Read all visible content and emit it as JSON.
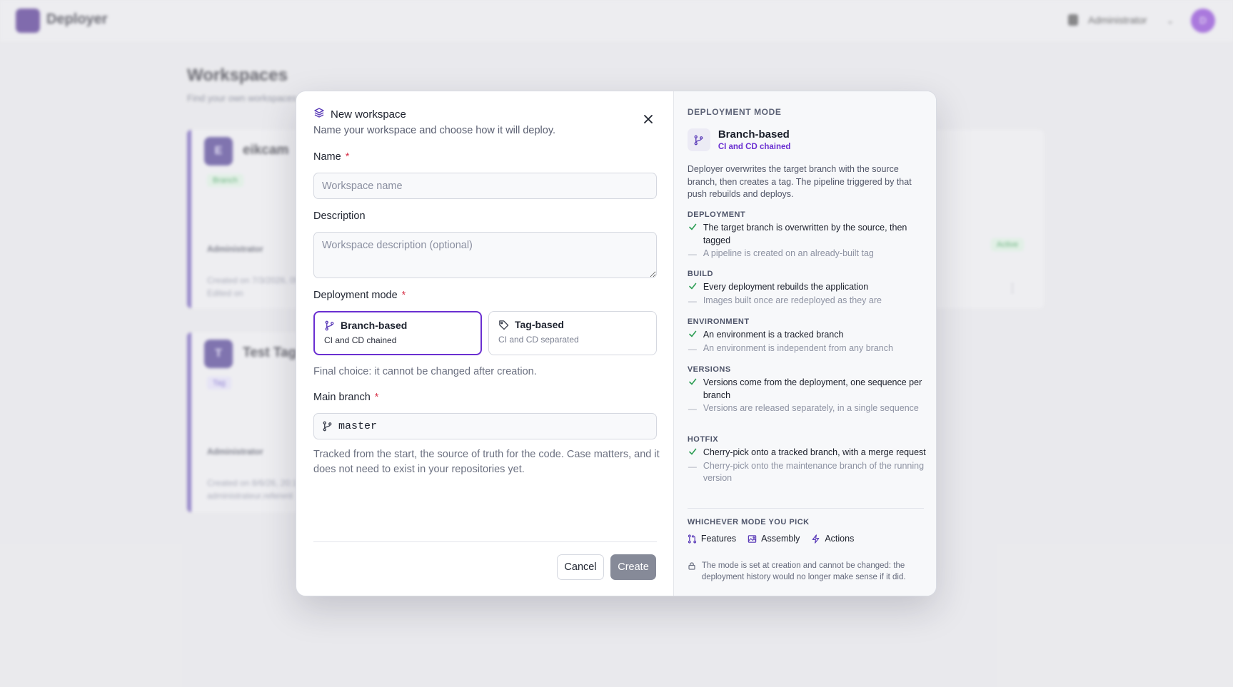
{
  "background": {
    "app_name": "Deployer",
    "user_role": "Administrator",
    "user_initial": "D",
    "page_title": "Workspaces",
    "page_subtitle": "Find your own workspaces",
    "cards": [
      {
        "initial": "E",
        "name": "eikcam",
        "badge": "Branch",
        "role": "Administrator",
        "meta": "Created on 7/3/2026, 09:",
        "meta2": "Edited on",
        "status": "Active"
      },
      {
        "initial": "T",
        "name": "Test Tag",
        "badge": "Tag",
        "role": "Administrator",
        "meta": "Created on 8/6/26, 20:12",
        "meta2": "administrateur.referent"
      }
    ]
  },
  "modal": {
    "title": "New workspace",
    "subtitle": "Name your workspace and choose how it will deploy.",
    "name_label": "Name",
    "name_placeholder": "Workspace name",
    "description_label": "Description",
    "description_placeholder": "Workspace description (optional)",
    "mode_label": "Deployment mode",
    "required_mark": "*",
    "modes": [
      {
        "title": "Branch-based",
        "subtitle": "CI and CD chained",
        "selected": true
      },
      {
        "title": "Tag-based",
        "subtitle": "CI and CD separated",
        "selected": false
      }
    ],
    "final_note": "Final choice: it cannot be changed after creation.",
    "branch_label": "Main branch",
    "branch_value": "master",
    "branch_help": "Tracked from the start, the source of truth for the code. Case matters, and it does not need to exist in your repositories yet.",
    "cancel_label": "Cancel",
    "create_label": "Create"
  },
  "panel": {
    "kicker": "DEPLOYMENT MODE",
    "mode_title": "Branch-based",
    "mode_subtitle": "CI and CD chained",
    "description": "Deployer overwrites the target branch with the source branch, then creates a tag. The pipeline triggered by that push rebuilds and deploys.",
    "sections": [
      {
        "heading": "DEPLOYMENT",
        "yes": "The target branch is overwritten by the source, then tagged",
        "no": "A pipeline is created on an already-built tag"
      },
      {
        "heading": "BUILD",
        "yes": "Every deployment rebuilds the application",
        "no": "Images built once are redeployed as they are"
      },
      {
        "heading": "ENVIRONMENT",
        "yes": "An environment is a tracked branch",
        "no": "An environment is independent from any branch"
      },
      {
        "heading": "VERSIONS",
        "yes": "Versions come from the deployment, one sequence per branch",
        "no": "Versions are released separately, in a single sequence"
      },
      {
        "heading": "HOTFIX",
        "yes": "Cherry-pick onto a tracked branch, with a merge request",
        "no": "Cherry-pick onto the maintenance branch of the running version"
      }
    ],
    "common_kicker": "WHICHEVER MODE YOU PICK",
    "common": [
      "Features",
      "Assembly",
      "Actions"
    ],
    "lock_note": "The mode is set at creation and cannot be changed: the deployment history would no longer make sense if it did."
  },
  "colors": {
    "accent": "#6a2fd1",
    "required": "#d8354b",
    "check": "#2e9e55",
    "create_disabled": "#868a98"
  },
  "icons": {
    "modal_title": "layers-icon",
    "close": "close-icon",
    "branch": "git-branch-icon",
    "tag": "tag-icon",
    "check": "check-icon",
    "dash": "dash-icon",
    "features": "git-pull-request-icon",
    "assembly": "image-frame-icon",
    "actions": "lightning-icon",
    "lock": "lock-icon"
  }
}
